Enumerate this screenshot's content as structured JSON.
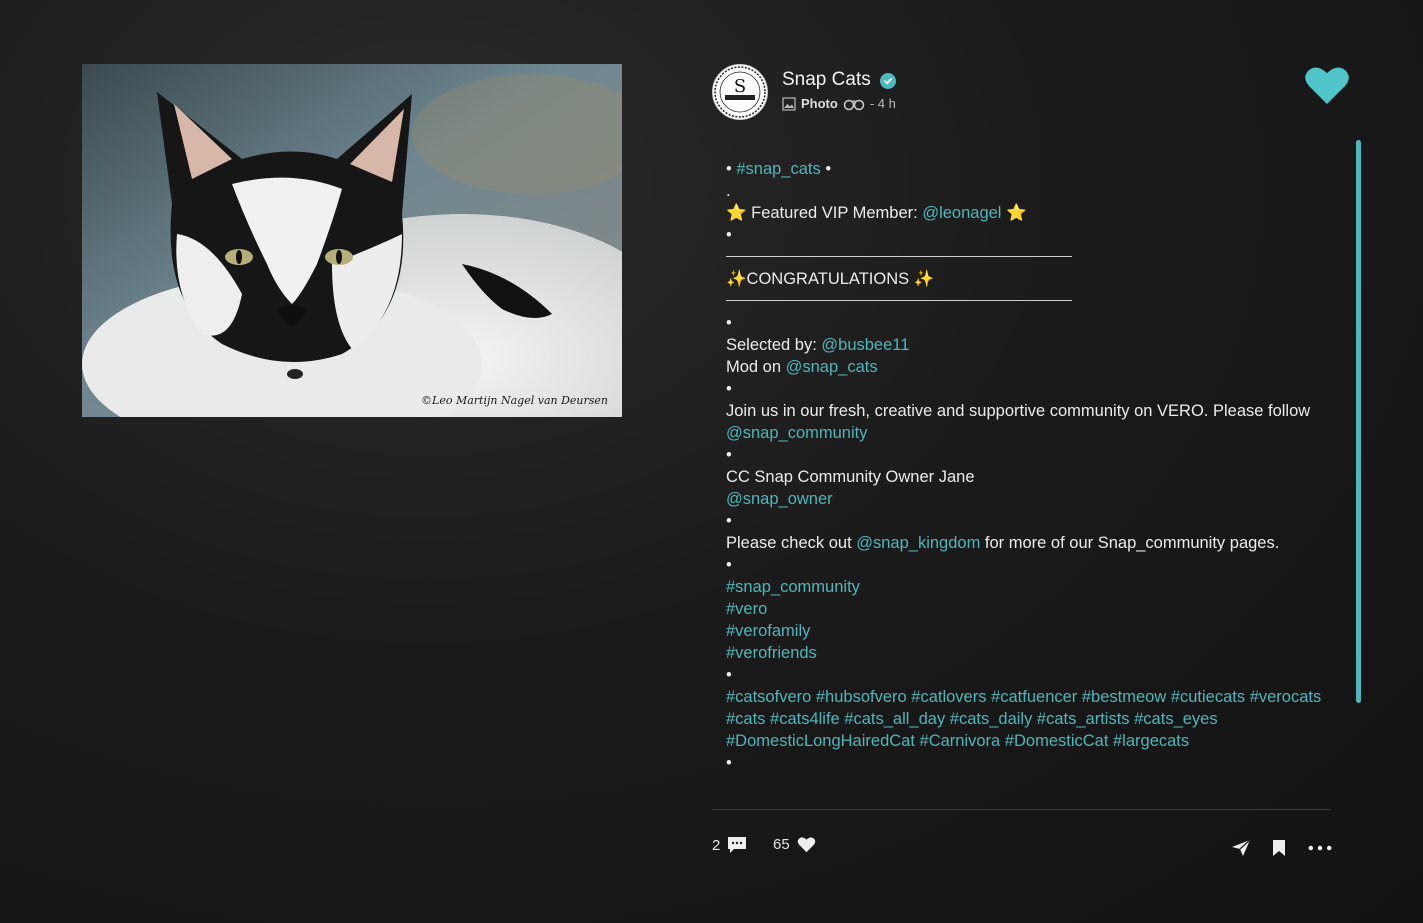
{
  "photo": {
    "credit": "©Leo Martijn Nagel van Deursen"
  },
  "post": {
    "user": "Snap Cats",
    "avatar_initial": "S",
    "type": "Photo",
    "time": "- 4 h",
    "verified_icon": "verified-check-icon",
    "like_icon": "heart-icon",
    "accent_color": "#4fb6bb"
  },
  "caption": {
    "l1a": "• ",
    "l1_tag": "#snap_cats",
    "l1b": " •",
    "l2": ".",
    "l3a": "⭐ Featured VIP Member: ",
    "l3_mention": "@leonagel",
    "l3b": " ⭐",
    "l4": "•",
    "congrats": "✨CONGRATULATIONS ✨",
    "l5": "•",
    "sel_a": "Selected by: ",
    "sel_mention": "@busbee11",
    "mod_a": "Mod on ",
    "mod_mention": "@snap_cats",
    "l6": "•",
    "join_a": "Join us in our fresh, creative and supportive community on VERO. Please follow ",
    "join_mention": "@snap_community",
    "l7": "•",
    "cc_a": "CC Snap Community Owner Jane",
    "cc_mention": "@snap_owner",
    "l8": "•",
    "check_a": "Please check out ",
    "check_mention": "@snap_kingdom",
    "check_b": " for more of our Snap_community pages.",
    "l9": "•",
    "tag1": "#snap_community",
    "tag2": "#vero",
    "tag3": "#verofamily",
    "tag4": "#verofriends",
    "l10": "•",
    "tags_block": "#catsofvero #hubsofvero #catlovers #catfuencer #bestmeow #cutiecats #verocats #cats #cats4life #cats_all_day #cats_daily #cats_artists #cats_eyes #DomesticLongHairedCat #Carnivora #DomesticCat #largecats",
    "l11": "•"
  },
  "footer": {
    "comments": "2",
    "likes": "65",
    "comment_icon": "comment-icon",
    "like_icon": "heart-icon",
    "share_icon": "send-icon",
    "bookmark_icon": "bookmark-icon",
    "more_icon": "more-icon"
  }
}
